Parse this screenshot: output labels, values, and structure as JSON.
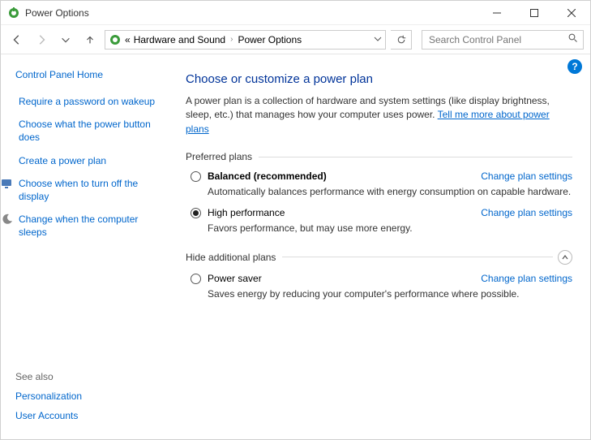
{
  "window": {
    "title": "Power Options"
  },
  "breadcrumb": {
    "prefix": "«",
    "item1": "Hardware and Sound",
    "item2": "Power Options"
  },
  "search": {
    "placeholder": "Search Control Panel"
  },
  "sidebar": {
    "home": "Control Panel Home",
    "links": [
      "Require a password on wakeup",
      "Choose what the power button does",
      "Create a power plan",
      "Choose when to turn off the display",
      "Change when the computer sleeps"
    ],
    "see_also_hdr": "See also",
    "see_also": [
      "Personalization",
      "User Accounts"
    ]
  },
  "main": {
    "heading": "Choose or customize a power plan",
    "description": "A power plan is a collection of hardware and system settings (like display brightness, sleep, etc.) that manages how your computer uses power. ",
    "description_link": "Tell me more about power plans",
    "preferred_hdr": "Preferred plans",
    "hide_hdr": "Hide additional plans",
    "change_link": "Change plan settings",
    "plans": {
      "balanced": {
        "title": "Balanced (recommended)",
        "desc": "Automatically balances performance with energy consumption on capable hardware."
      },
      "high": {
        "title": "High performance",
        "desc": "Favors performance, but may use more energy."
      },
      "saver": {
        "title": "Power saver",
        "desc": "Saves energy by reducing your computer's performance where possible."
      }
    }
  }
}
